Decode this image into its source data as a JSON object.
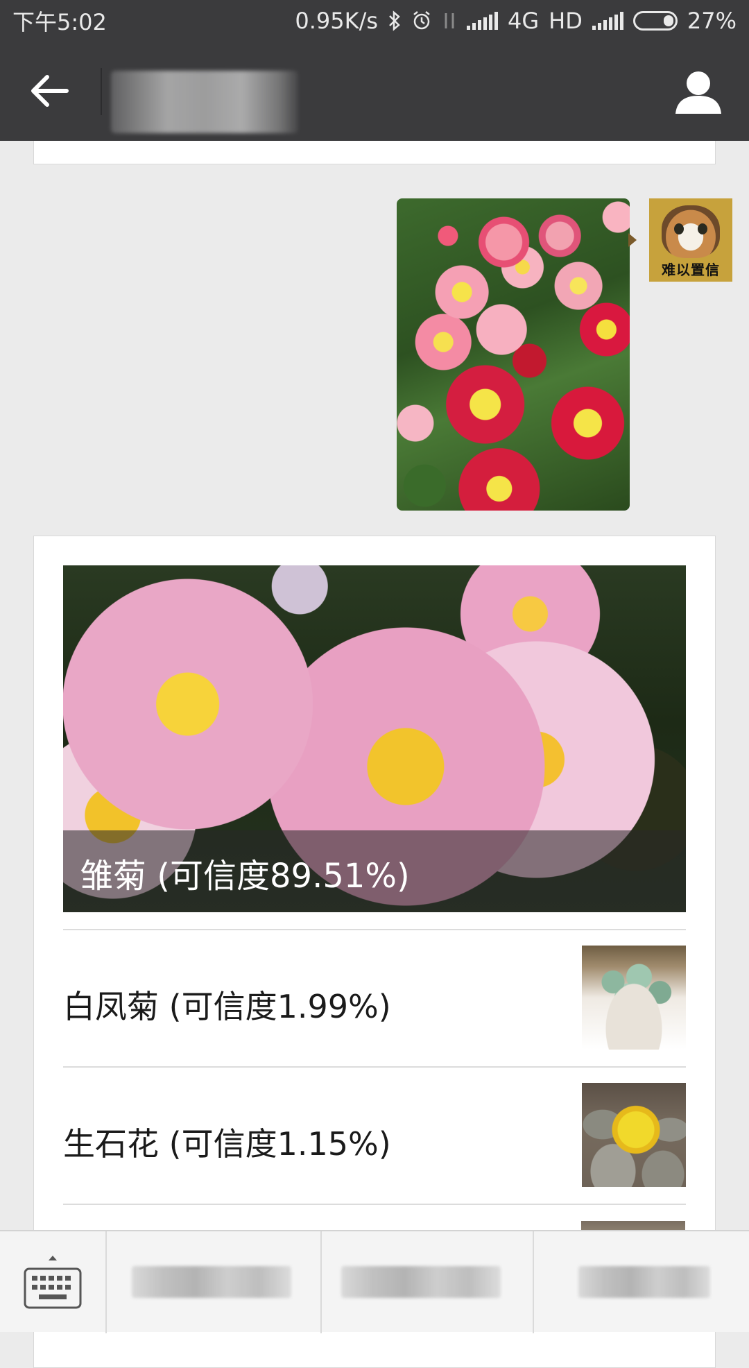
{
  "status_bar": {
    "time": "下午5:02",
    "network_speed": "0.95K/s",
    "network_type": "4G",
    "hd_label": "HD",
    "battery": "27%"
  },
  "header": {
    "back_icon": "arrow-left-icon",
    "profile_icon": "person-icon"
  },
  "messages": {
    "avatar_caption": "难以置信"
  },
  "result": {
    "top": {
      "name": "雏菊",
      "confidence_text": "(可信度89.51%)",
      "label": "雏菊 (可信度89.51%)"
    },
    "others": [
      {
        "label": "白凤菊 (可信度1.99%)"
      },
      {
        "label": "生石花 (可信度1.15%)"
      }
    ]
  },
  "bottom_bar": {
    "keyboard_icon": "keyboard-icon"
  },
  "colors": {
    "bar_dark": "#3b3b3d",
    "chat_bg": "#ebebeb",
    "card_bg": "#ffffff"
  }
}
